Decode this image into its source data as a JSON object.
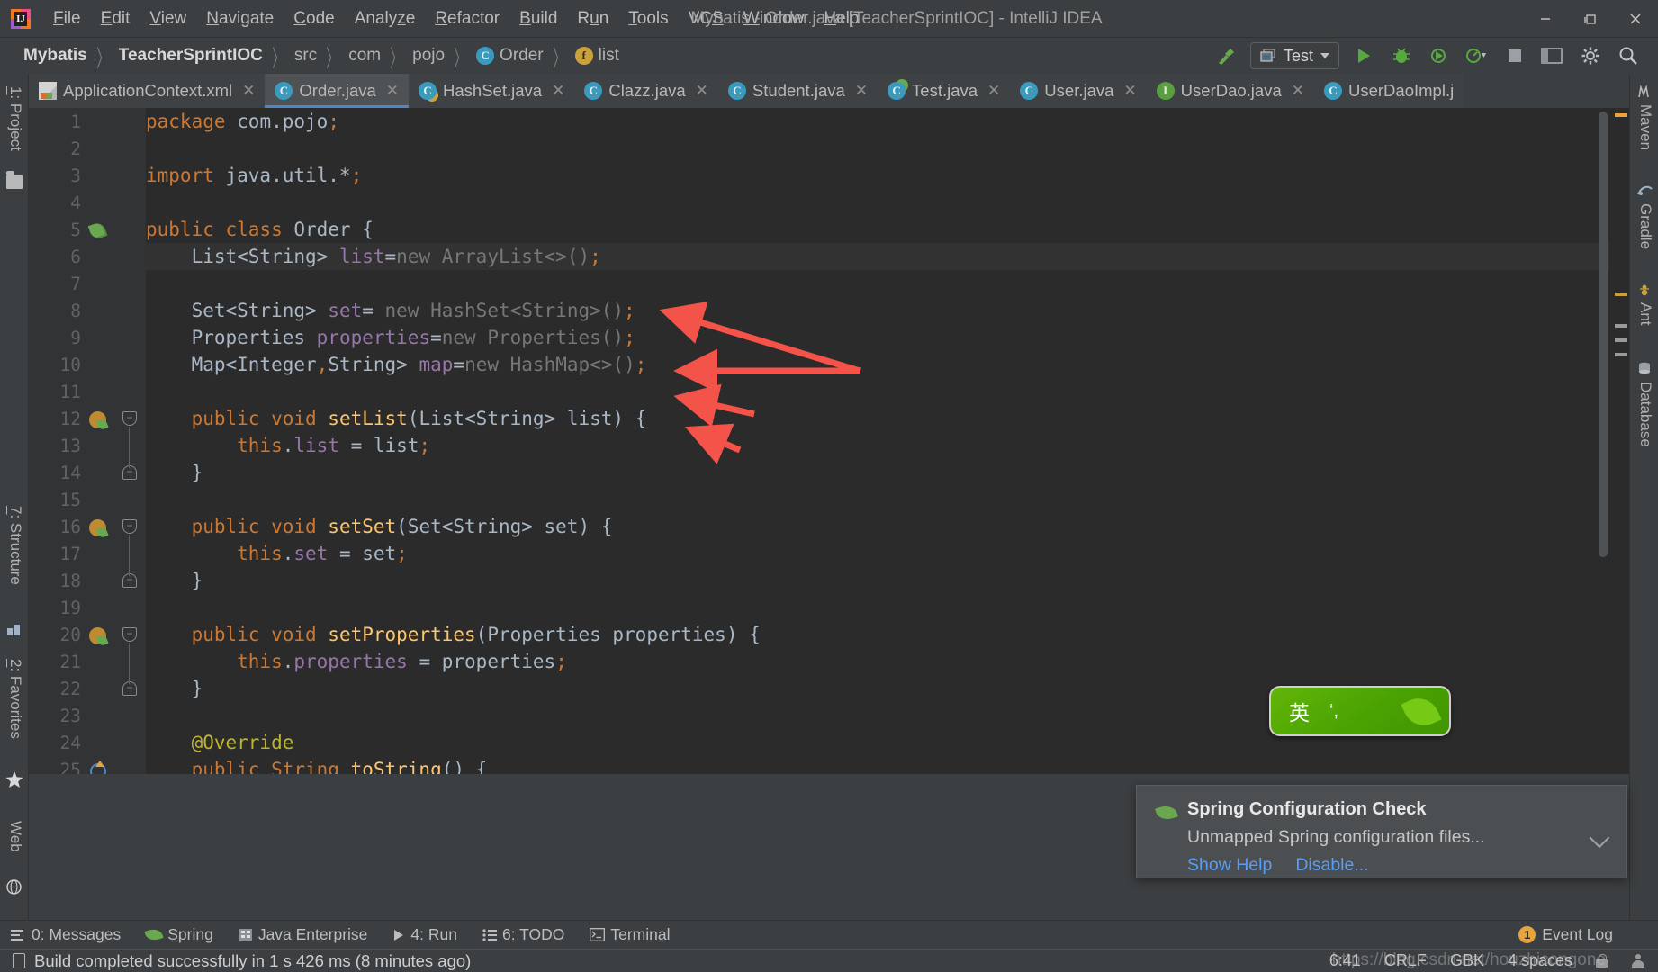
{
  "window": {
    "title": "Mybatis - Order.java [TeacherSprintIOC] - IntelliJ IDEA",
    "minimize": "–",
    "maximize": "❐",
    "close": "✕"
  },
  "menubar": {
    "items": [
      {
        "label": "File",
        "mnemonic": "F"
      },
      {
        "label": "Edit",
        "mnemonic": "E"
      },
      {
        "label": "View",
        "mnemonic": "V"
      },
      {
        "label": "Navigate",
        "mnemonic": "N"
      },
      {
        "label": "Code",
        "mnemonic": "C"
      },
      {
        "label": "Analyze",
        "mnemonic": "z"
      },
      {
        "label": "Refactor",
        "mnemonic": "R"
      },
      {
        "label": "Build",
        "mnemonic": "B"
      },
      {
        "label": "Run",
        "mnemonic": "u"
      },
      {
        "label": "Tools",
        "mnemonic": "T"
      },
      {
        "label": "VCS",
        "mnemonic": "S"
      },
      {
        "label": "Window",
        "mnemonic": "W"
      },
      {
        "label": "Help",
        "mnemonic": "H"
      }
    ]
  },
  "breadcrumb": {
    "separator": "〉",
    "items": [
      {
        "label": "Mybatis",
        "icon": "",
        "bold": true
      },
      {
        "label": "TeacherSprintIOC",
        "icon": "",
        "bold": true
      },
      {
        "label": "src",
        "icon": "",
        "bold": false
      },
      {
        "label": "com",
        "icon": "",
        "bold": false
      },
      {
        "label": "pojo",
        "icon": "",
        "bold": false
      },
      {
        "label": "Order",
        "icon": "class-icon",
        "badge": "C",
        "bold": false
      },
      {
        "label": "list",
        "icon": "field-icon",
        "badge": "f",
        "bold": false
      }
    ]
  },
  "toolbar": {
    "build_icon": "hammer-icon",
    "run_config": "Test",
    "run_icon": "run-icon",
    "debug_icon": "debug-icon",
    "coverage_icon": "run-with-coverage-icon",
    "profile_icon": "profile-icon",
    "stop_icon": "stop-icon",
    "layout_icon": "restore-layout-icon",
    "settings_icon": "gear-icon",
    "search_icon": "search-icon"
  },
  "tabs": [
    {
      "label": "ApplicationContext.xml",
      "icon": "xml-file-icon",
      "badge": "",
      "active": false,
      "closable": true
    },
    {
      "label": "Order.java",
      "icon": "java-class-icon",
      "badge": "C",
      "active": true,
      "closable": true
    },
    {
      "label": "HashSet.java",
      "icon": "java-class-readonly-icon",
      "badge": "C",
      "active": false,
      "closable": true
    },
    {
      "label": "Clazz.java",
      "icon": "java-class-icon",
      "badge": "C",
      "active": false,
      "closable": true
    },
    {
      "label": "Student.java",
      "icon": "java-class-icon",
      "badge": "C",
      "active": false,
      "closable": true
    },
    {
      "label": "Test.java",
      "icon": "java-runnable-class-icon",
      "badge": "C",
      "active": false,
      "closable": true
    },
    {
      "label": "User.java",
      "icon": "java-class-icon",
      "badge": "C",
      "active": false,
      "closable": true
    },
    {
      "label": "UserDao.java",
      "icon": "java-interface-icon",
      "badge": "I",
      "active": false,
      "closable": true
    },
    {
      "label": "UserDaoImpl.j",
      "icon": "java-class-icon",
      "badge": "C",
      "active": false,
      "closable": false
    }
  ],
  "editor": {
    "file": "Order.java",
    "cursor": "6:41",
    "line_separator": "CRLF",
    "encoding": "GBK",
    "indent": "4 spaces",
    "lines": [
      {
        "num": 1,
        "gutter": "",
        "fold": "",
        "highlight": false,
        "tokens": [
          {
            "t": "package",
            "c": "kw"
          },
          {
            "t": " com.pojo",
            "c": "grey"
          },
          {
            "t": ";",
            "c": "semi"
          }
        ]
      },
      {
        "num": 2,
        "gutter": "",
        "fold": "",
        "highlight": false,
        "tokens": []
      },
      {
        "num": 3,
        "gutter": "",
        "fold": "",
        "highlight": false,
        "tokens": [
          {
            "t": "import",
            "c": "kw"
          },
          {
            "t": " java.util.*",
            "c": "grey"
          },
          {
            "t": ";",
            "c": "semi"
          }
        ]
      },
      {
        "num": 4,
        "gutter": "",
        "fold": "",
        "highlight": false,
        "tokens": []
      },
      {
        "num": 5,
        "gutter": "spring-bean-icon",
        "fold": "",
        "highlight": false,
        "tokens": [
          {
            "t": "public class",
            "c": "kw"
          },
          {
            "t": " Order {",
            "c": "grey"
          }
        ]
      },
      {
        "num": 6,
        "gutter": "",
        "fold": "",
        "highlight": true,
        "tokens": [
          {
            "t": "    List<String> ",
            "c": "grey"
          },
          {
            "t": "list",
            "c": "fld2"
          },
          {
            "t": "=",
            "c": "punct"
          },
          {
            "t": "new",
            "c": "dim"
          },
          {
            "t": " ArrayList<>()",
            "c": "dim"
          },
          {
            "t": ";",
            "c": "semi"
          }
        ]
      },
      {
        "num": 7,
        "gutter": "",
        "fold": "",
        "highlight": false,
        "tokens": []
      },
      {
        "num": 8,
        "gutter": "",
        "fold": "",
        "highlight": false,
        "tokens": [
          {
            "t": "    Set<String> ",
            "c": "grey"
          },
          {
            "t": "set",
            "c": "fld2"
          },
          {
            "t": "= ",
            "c": "punct"
          },
          {
            "t": "new",
            "c": "dim"
          },
          {
            "t": " HashSet<String>()",
            "c": "dim"
          },
          {
            "t": ";",
            "c": "semi"
          }
        ]
      },
      {
        "num": 9,
        "gutter": "",
        "fold": "",
        "highlight": false,
        "tokens": [
          {
            "t": "    Properties ",
            "c": "grey"
          },
          {
            "t": "properties",
            "c": "fld2"
          },
          {
            "t": "=",
            "c": "punct"
          },
          {
            "t": "new",
            "c": "dim"
          },
          {
            "t": " Properties()",
            "c": "dim"
          },
          {
            "t": ";",
            "c": "semi"
          }
        ]
      },
      {
        "num": 10,
        "gutter": "",
        "fold": "",
        "highlight": false,
        "tokens": [
          {
            "t": "    Map<Integer",
            "c": "grey"
          },
          {
            "t": ",",
            "c": "semi"
          },
          {
            "t": "String> ",
            "c": "grey"
          },
          {
            "t": "map",
            "c": "fld2"
          },
          {
            "t": "=",
            "c": "punct"
          },
          {
            "t": "new",
            "c": "dim"
          },
          {
            "t": " HashMap<>()",
            "c": "dim"
          },
          {
            "t": ";",
            "c": "semi"
          }
        ]
      },
      {
        "num": 11,
        "gutter": "",
        "fold": "",
        "highlight": false,
        "tokens": []
      },
      {
        "num": 12,
        "gutter": "spring-bean-property-icon",
        "fold": "top",
        "highlight": false,
        "tokens": [
          {
            "t": "    public void ",
            "c": "kw"
          },
          {
            "t": "setList",
            "c": "mname"
          },
          {
            "t": "(List<String> list) {",
            "c": "grey"
          }
        ]
      },
      {
        "num": 13,
        "gutter": "",
        "fold": "",
        "highlight": false,
        "tokens": [
          {
            "t": "        this",
            "c": "kw"
          },
          {
            "t": ".",
            "c": "punct"
          },
          {
            "t": "list",
            "c": "fld2"
          },
          {
            "t": " = list",
            "c": "grey"
          },
          {
            "t": ";",
            "c": "semi"
          }
        ]
      },
      {
        "num": 14,
        "gutter": "",
        "fold": "bottom",
        "highlight": false,
        "tokens": [
          {
            "t": "    }",
            "c": "grey"
          }
        ]
      },
      {
        "num": 15,
        "gutter": "",
        "fold": "",
        "highlight": false,
        "tokens": []
      },
      {
        "num": 16,
        "gutter": "spring-bean-property-icon",
        "fold": "top",
        "highlight": false,
        "tokens": [
          {
            "t": "    public void ",
            "c": "kw"
          },
          {
            "t": "setSet",
            "c": "mname"
          },
          {
            "t": "(Set<String> set) {",
            "c": "grey"
          }
        ]
      },
      {
        "num": 17,
        "gutter": "",
        "fold": "",
        "highlight": false,
        "tokens": [
          {
            "t": "        this",
            "c": "kw"
          },
          {
            "t": ".",
            "c": "punct"
          },
          {
            "t": "set",
            "c": "fld2"
          },
          {
            "t": " = set",
            "c": "grey"
          },
          {
            "t": ";",
            "c": "semi"
          }
        ]
      },
      {
        "num": 18,
        "gutter": "",
        "fold": "bottom",
        "highlight": false,
        "tokens": [
          {
            "t": "    }",
            "c": "grey"
          }
        ]
      },
      {
        "num": 19,
        "gutter": "",
        "fold": "",
        "highlight": false,
        "tokens": []
      },
      {
        "num": 20,
        "gutter": "spring-bean-property-icon",
        "fold": "top",
        "highlight": false,
        "tokens": [
          {
            "t": "    public void ",
            "c": "kw"
          },
          {
            "t": "setProperties",
            "c": "mname"
          },
          {
            "t": "(Properties properties) {",
            "c": "grey"
          }
        ]
      },
      {
        "num": 21,
        "gutter": "",
        "fold": "",
        "highlight": false,
        "tokens": [
          {
            "t": "        this",
            "c": "kw"
          },
          {
            "t": ".",
            "c": "punct"
          },
          {
            "t": "properties",
            "c": "fld2"
          },
          {
            "t": " = properties",
            "c": "grey"
          },
          {
            "t": ";",
            "c": "semi"
          }
        ]
      },
      {
        "num": 22,
        "gutter": "",
        "fold": "bottom",
        "highlight": false,
        "tokens": [
          {
            "t": "    }",
            "c": "grey"
          }
        ]
      },
      {
        "num": 23,
        "gutter": "",
        "fold": "",
        "highlight": false,
        "tokens": []
      },
      {
        "num": 24,
        "gutter": "",
        "fold": "",
        "highlight": false,
        "tokens": [
          {
            "t": "    @Override",
            "c": "anno"
          }
        ]
      },
      {
        "num": 25,
        "gutter": "override-icon",
        "fold": "",
        "highlight": false,
        "tokens": [
          {
            "t": "    public String ",
            "c": "kw"
          },
          {
            "t": "toString",
            "c": "mname"
          },
          {
            "t": "() {",
            "c": "grey"
          }
        ]
      }
    ]
  },
  "ime": {
    "mode": "英",
    "punct": "‘,"
  },
  "notification": {
    "icon": "spring-leaf-icon",
    "title": "Spring Configuration Check",
    "body": "Unmapped Spring configuration files...",
    "links": [
      "Show Help",
      "Disable..."
    ],
    "collapse_icon": "chevron-down-icon"
  },
  "left_sidebar": [
    {
      "label": "1: Project",
      "mnemonic": "1",
      "icon": "folder-icon"
    },
    {
      "label": "7: Structure",
      "mnemonic": "7",
      "icon": "structure-icon"
    },
    {
      "label": "2: Favorites",
      "mnemonic": "2",
      "icon": "star-icon"
    },
    {
      "label": "Web",
      "mnemonic": "",
      "icon": "web-icon"
    }
  ],
  "right_sidebar": [
    {
      "label": "Maven",
      "icon": "maven-icon"
    },
    {
      "label": "Gradle",
      "icon": "gradle-icon"
    },
    {
      "label": "Ant",
      "icon": "ant-icon"
    },
    {
      "label": "Database",
      "icon": "database-icon"
    }
  ],
  "bottom_bar": {
    "items": [
      {
        "label": "0: Messages",
        "mnemonic": "0",
        "icon": "messages-icon"
      },
      {
        "label": "Spring",
        "mnemonic": "",
        "icon": "spring-leaf-icon"
      },
      {
        "label": "Java Enterprise",
        "mnemonic": "",
        "icon": "java-enterprise-icon"
      },
      {
        "label": "4: Run",
        "mnemonic": "4",
        "icon": "run-icon"
      },
      {
        "label": "6: TODO",
        "mnemonic": "6",
        "icon": "todo-icon"
      },
      {
        "label": "Terminal",
        "mnemonic": "",
        "icon": "terminal-icon"
      }
    ],
    "event_log": {
      "label": "Event Log",
      "count": "1"
    }
  },
  "status_bar": {
    "icon": "build-icon",
    "message": "Build completed successfully in 1 s 426 ms (8 minutes ago)",
    "cursor": "6:41",
    "line_separator": "CRLF",
    "encoding": "GBK",
    "indent": "4 spaces",
    "lock_icon": "lock-icon",
    "user_icon": "user-icon",
    "watermark": "https://blog.csdn.net/houzhicongone"
  },
  "colors": {
    "accent": "#4a88c7",
    "keyword": "#cc7832",
    "method": "#ffc66d",
    "field": "#9876aa",
    "text": "#a9b7c6",
    "annotation": "#bbb529",
    "editor_bg": "#2b2b2b",
    "panel_bg": "#3c3f41",
    "arrow": "#f4534a",
    "link": "#589df6"
  },
  "annotations": {
    "arrow_count": 4,
    "arrow_color": "#f4534a",
    "targets": [
      "ArrayList<>() line 6",
      "HashSet<String>() line 8",
      "Properties() line 9",
      "HashMap<>() line 10"
    ]
  }
}
